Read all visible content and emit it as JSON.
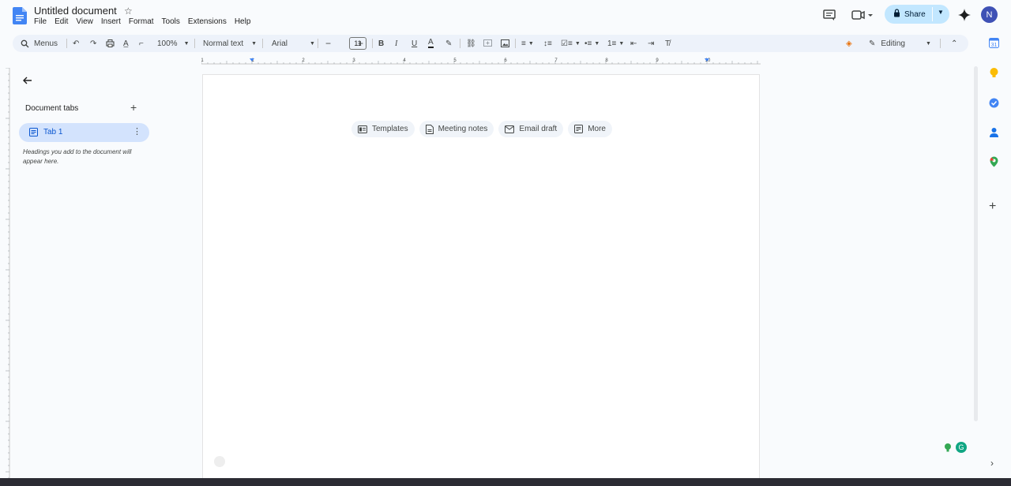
{
  "header": {
    "doc_title": "Untitled document",
    "menus": [
      "File",
      "Edit",
      "View",
      "Insert",
      "Format",
      "Tools",
      "Extensions",
      "Help"
    ],
    "share_label": "Share",
    "avatar_letter": "N"
  },
  "toolbar": {
    "search_menus": "Menus",
    "zoom": "100%",
    "style": "Normal text",
    "font": "Arial",
    "font_size": "11",
    "mode": "Editing"
  },
  "ruler": {
    "labels": [
      "1",
      "1",
      "2",
      "3",
      "4",
      "5",
      "6",
      "7",
      "8",
      "9",
      "10"
    ]
  },
  "sidebar": {
    "title": "Document tabs",
    "tab_label": "Tab 1",
    "hint": "Headings you add to the document will appear here."
  },
  "chips": [
    {
      "label": "Templates",
      "icon": "templates-icon"
    },
    {
      "label": "Meeting notes",
      "icon": "document-icon"
    },
    {
      "label": "Email draft",
      "icon": "mail-icon"
    },
    {
      "label": "More",
      "icon": "more-icon"
    }
  ],
  "colors": {
    "accent": "#0b57d0",
    "share_bg": "#c2e7ff",
    "toolbar_bg": "#edf2fa",
    "tab_active_bg": "#d3e3fd"
  }
}
